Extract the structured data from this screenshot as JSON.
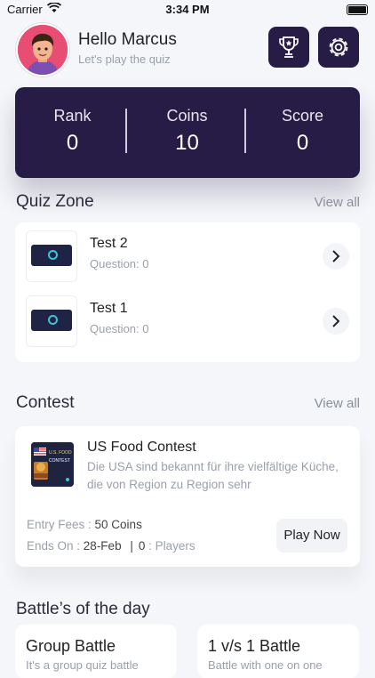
{
  "status_bar": {
    "carrier": "Carrier",
    "time": "3:34 PM"
  },
  "header": {
    "greeting": "Hello Marcus",
    "subtitle": "Let's play the quiz",
    "trophy_icon": "trophy-icon",
    "gear_icon": "gear-icon"
  },
  "stats": [
    {
      "label": "Rank",
      "value": "0"
    },
    {
      "label": "Coins",
      "value": "10"
    },
    {
      "label": "Score",
      "value": "0"
    }
  ],
  "quiz_zone": {
    "title": "Quiz Zone",
    "view_all": "View all",
    "items": [
      {
        "title": "Test 2",
        "subtitle": "Question: 0"
      },
      {
        "title": "Test 1",
        "subtitle": "Question: 0"
      }
    ]
  },
  "contest": {
    "title": "Contest",
    "view_all": "View all",
    "item": {
      "title": "US Food Contest",
      "description": "Die USA sind bekannt für ihre vielfältige Küche, die von Region zu Region sehr",
      "thumb_label_1": "U.S. FOOD",
      "thumb_label_2": "CONTEST",
      "fees_label": "Entry Fees : ",
      "fees_value": "50 Coins",
      "ends_label": "Ends On : ",
      "ends_value": "28-Feb",
      "separator": "|",
      "players_count": "0",
      "players_label": " : Players",
      "play_button": "Play Now"
    }
  },
  "battles": {
    "title": "Battle’s of the day",
    "items": [
      {
        "title": "Group Battle",
        "desc": "It's a group quiz battle"
      },
      {
        "title": "1 v/s 1 Battle",
        "desc": "Battle with one on one"
      }
    ]
  },
  "colors": {
    "primary": "#261c45",
    "background": "#f4f6f9",
    "avatar_bg": "#e84d74"
  }
}
